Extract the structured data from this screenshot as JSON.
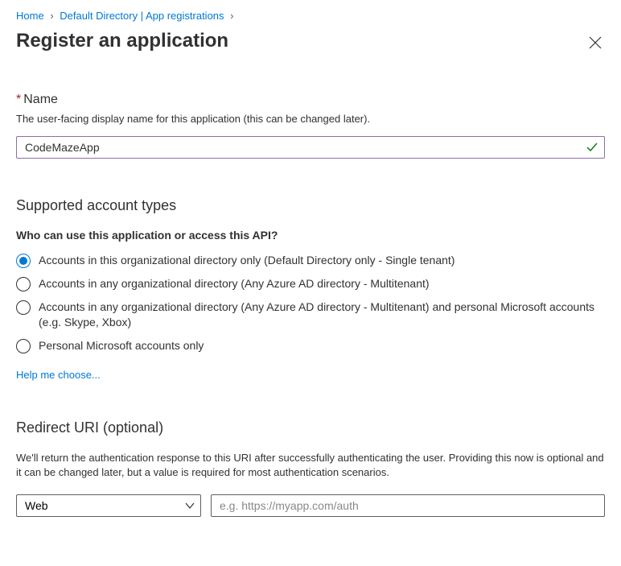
{
  "breadcrumb": {
    "home": "Home",
    "directory": "Default Directory | App registrations"
  },
  "title": "Register an application",
  "name_section": {
    "label": "Name",
    "helper": "The user-facing display name for this application (this can be changed later).",
    "value": "CodeMazeApp"
  },
  "account_types": {
    "heading": "Supported account types",
    "question": "Who can use this application or access this API?",
    "options": [
      "Accounts in this organizational directory only (Default Directory only - Single tenant)",
      "Accounts in any organizational directory (Any Azure AD directory - Multitenant)",
      "Accounts in any organizational directory (Any Azure AD directory - Multitenant) and personal Microsoft accounts (e.g. Skype, Xbox)",
      "Personal Microsoft accounts only"
    ],
    "selected": 0,
    "help_link": "Help me choose..."
  },
  "redirect": {
    "heading": "Redirect URI (optional)",
    "helper": "We'll return the authentication response to this URI after successfully authenticating the user. Providing this now is optional and it can be changed later, but a value is required for most authentication scenarios.",
    "platform": "Web",
    "uri_placeholder": "e.g. https://myapp.com/auth"
  }
}
